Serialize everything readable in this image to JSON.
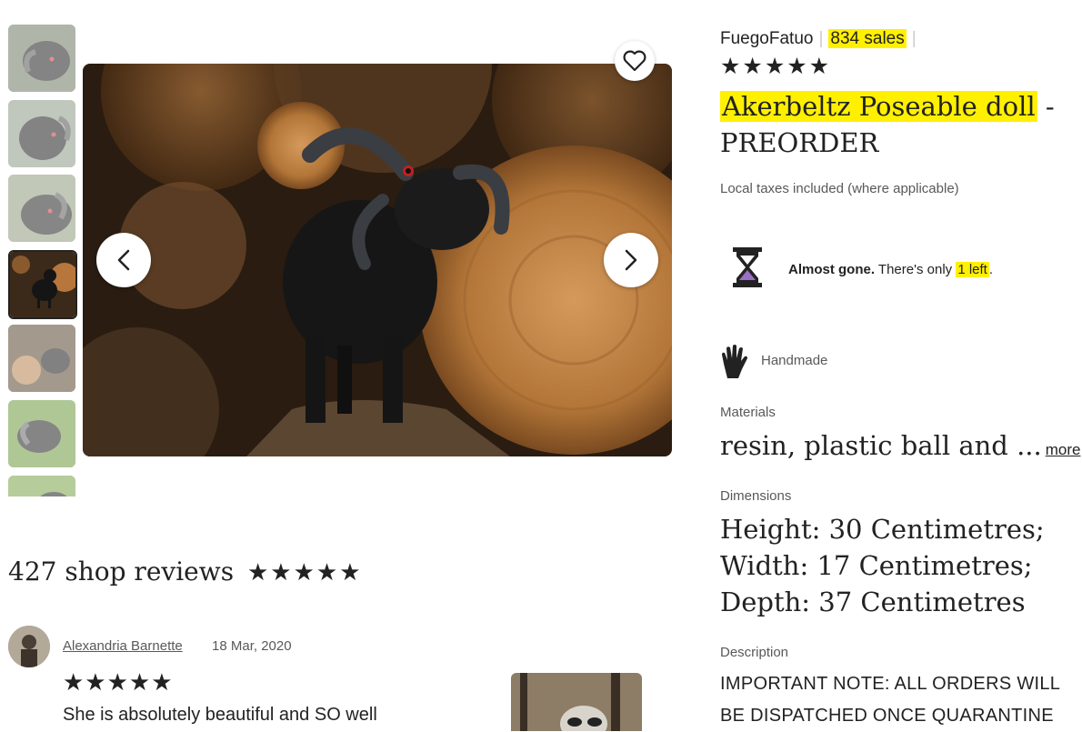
{
  "gallery": {
    "thumbnail_count": 7,
    "active_index": 3
  },
  "icons": {
    "favorite": "heart-icon",
    "prev": "chevron-left-icon",
    "next": "chevron-right-icon",
    "stock": "hourglass-icon",
    "handmade": "hand-icon"
  },
  "shop": {
    "name": "FuegoFatuo",
    "sales": "834 sales",
    "rating_stars": "★★★★★"
  },
  "listing": {
    "title_highlight": "Akerbeltz Poseable doll",
    "title_rest": " - PREORDER",
    "taxes_note": "Local taxes included (where applicable)",
    "stock_bold": "Almost gone.",
    "stock_text": " There's only ",
    "stock_count": "1 left",
    "stock_end": ".",
    "handmade_label": "Handmade",
    "materials_label": "Materials",
    "materials_value": "resin, plastic ball and ...",
    "more_link": "more",
    "dimensions_label": "Dimensions",
    "dimensions": [
      "Height: 30 Centimetres;",
      "Width: 17 Centimetres;",
      "Depth: 37 Centimetres"
    ],
    "description_label": "Description",
    "description_text": "IMPORTANT NOTE: ALL ORDERS WILL BE DISPATCHED ONCE QUARANTINE"
  },
  "reviews": {
    "title": "427 shop reviews",
    "stars": "★★★★★",
    "items": [
      {
        "author": "Alexandria Barnette",
        "date": "18 Mar, 2020",
        "stars": "★★★★★",
        "text": "She is absolutely beautiful and SO well"
      }
    ]
  },
  "colors": {
    "highlight": "#fff000",
    "text": "#222222",
    "muted": "#595959",
    "hourglass_sand": "#9b6fc4"
  }
}
